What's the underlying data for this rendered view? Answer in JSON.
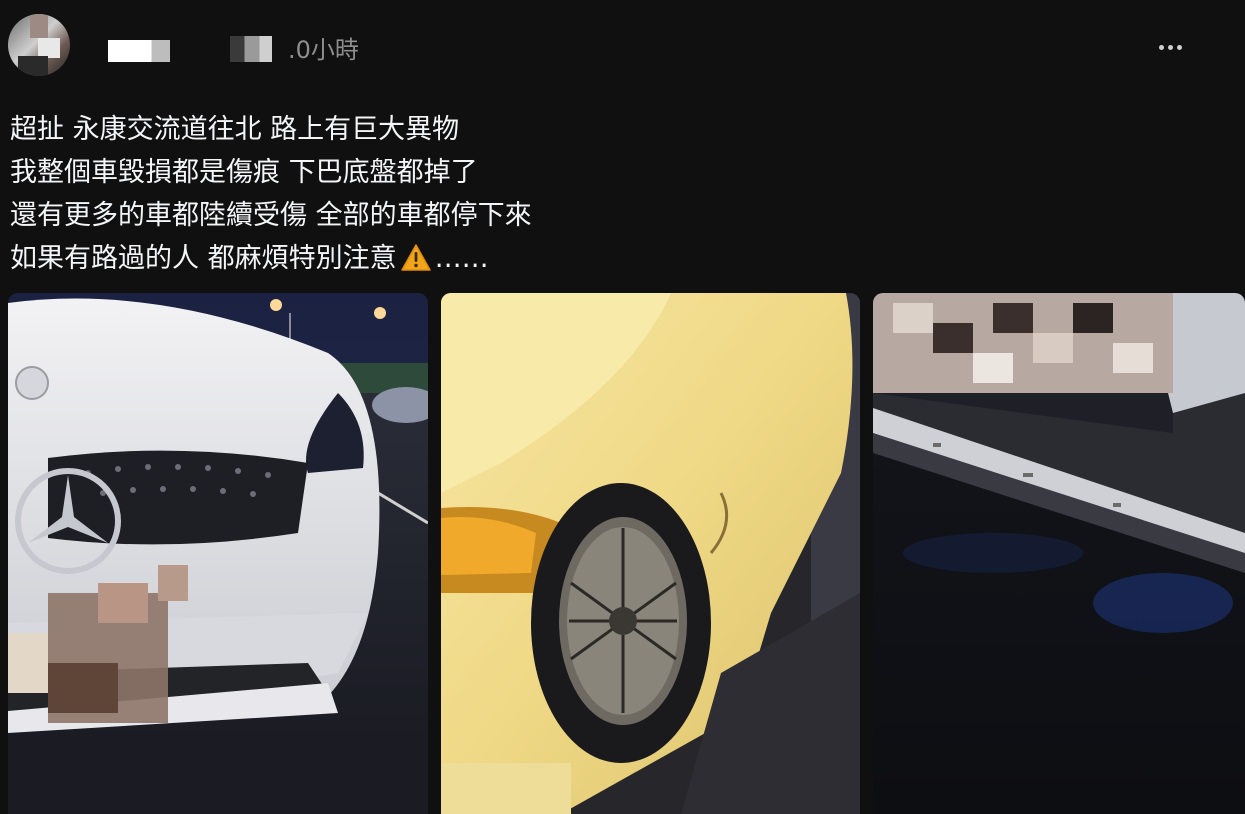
{
  "post": {
    "time_label": ".0小時",
    "more_icon": "more-horizontal-icon",
    "lines": [
      "超扯 永康交流道往北 路上有巨大異物",
      "我整個車毀損都是傷痕 下巴底盤都掉了",
      "還有更多的車都陸續受傷 全部的車都停下來",
      "如果有路過的人 都麻煩特別注意"
    ],
    "warning_icon": "warning-icon",
    "trailing_text": "……"
  },
  "photos": [
    {
      "icon": "image-front-damage"
    },
    {
      "icon": "image-side-damage"
    },
    {
      "icon": "image-underbody-damage"
    }
  ],
  "colors": {
    "background": "#101010",
    "text": "#f3f5f7",
    "muted": "#8e8e8e",
    "warning": "#f2a51a"
  }
}
